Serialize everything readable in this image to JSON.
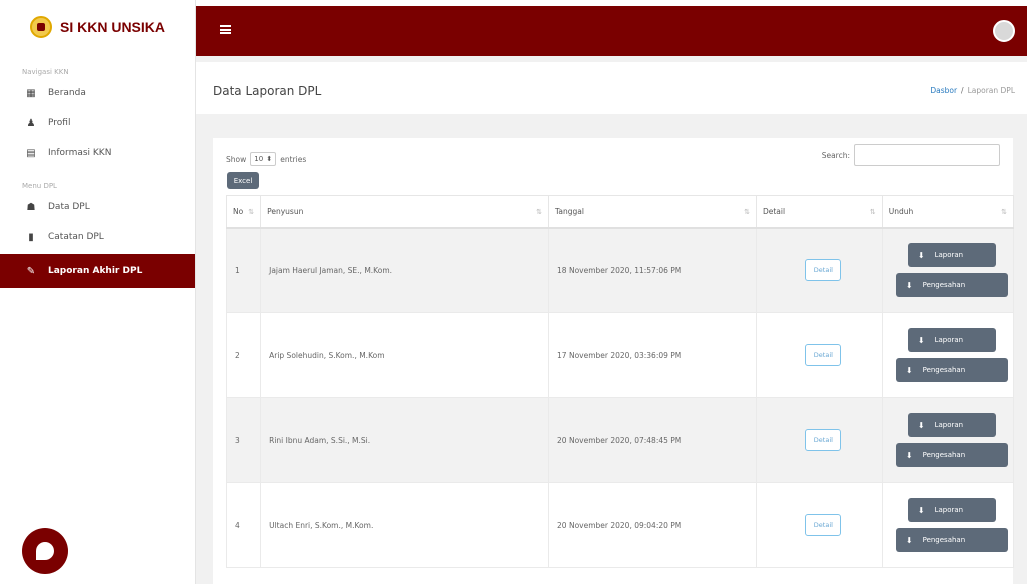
{
  "sidebar": {
    "brand": "SI KKN UNSIKA",
    "sections": [
      {
        "label": "Navigasi KKN"
      },
      {
        "label": "Menu DPL"
      }
    ],
    "items": [
      {
        "label": "Beranda",
        "icon": "dashboard-icon"
      },
      {
        "label": "Profil",
        "icon": "user-icon"
      },
      {
        "label": "Informasi KKN",
        "icon": "calendar-icon"
      },
      {
        "label": "Data DPL",
        "icon": "users-icon"
      },
      {
        "label": "Catatan DPL",
        "icon": "file-icon"
      },
      {
        "label": "Laporan Akhir DPL",
        "icon": "edit-icon",
        "active": true
      }
    ]
  },
  "header": {
    "title": "Data Laporan DPL",
    "breadcrumb": [
      "Dasbor",
      "Laporan DPL"
    ]
  },
  "table_controls": {
    "show_label": "Show",
    "entries_value": "10",
    "entries_label": "entries",
    "search_label": "Search:",
    "search_value": "",
    "excel_label": "Excel"
  },
  "table": {
    "columns": [
      "No",
      "Penyusun",
      "Tanggal",
      "Detail",
      "Unduh"
    ],
    "rows": [
      {
        "no": "1",
        "penyusun": "Jajam Haerul Jaman, SE., M.Kom.",
        "tanggal": "18 November 2020, 11:57:06 PM"
      },
      {
        "no": "2",
        "penyusun": "Arip Solehudin, S.Kom., M.Kom",
        "tanggal": "17 November 2020, 03:36:09 PM"
      },
      {
        "no": "3",
        "penyusun": "Rini Ibnu Adam, S.Si., M.Si.",
        "tanggal": "20 November 2020, 07:48:45 PM"
      },
      {
        "no": "4",
        "penyusun": "Ultach Enri, S.Kom., M.Kom.",
        "tanggal": "20 November 2020, 09:04:20 PM"
      }
    ],
    "detail_label": "Detail",
    "laporan_label": "Laporan",
    "pengesahan_label": "Pengesahan"
  },
  "colors": {
    "brand": "#7a0000",
    "button_dark": "#5d6a79",
    "link": "#2a7bbf"
  }
}
